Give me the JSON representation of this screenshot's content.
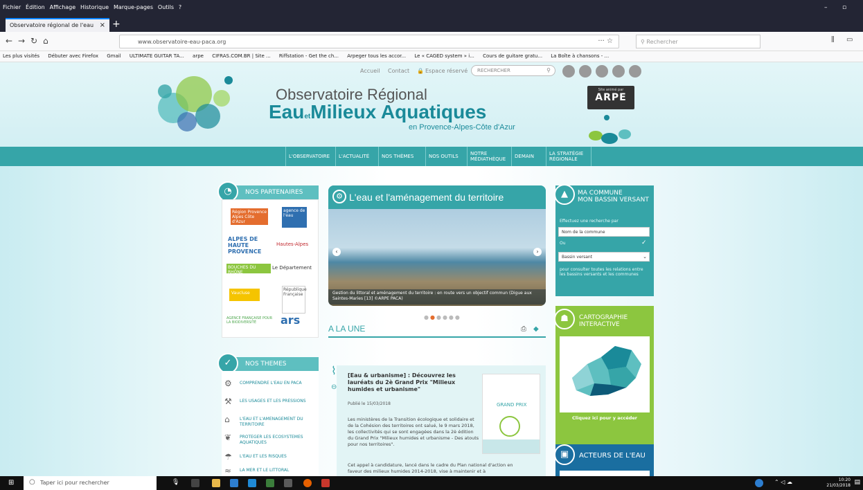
{
  "browser": {
    "menu": [
      "Fichier",
      "Édition",
      "Affichage",
      "Historique",
      "Marque-pages",
      "Outils",
      "?"
    ],
    "tab_title": "Observatoire régional de l'eau",
    "url": "www.observatoire-eau-paca.org",
    "search_placeholder": "Rechercher",
    "bookmarks": [
      "Les plus visités",
      "Débuter avec Firefox",
      "Gmail",
      "ULTIMATE GUITAR TA...",
      "arpe",
      "CIFRAS.COM.BR | Site ...",
      "Riffstation - Get the ch...",
      "Arpeger tous les accor...",
      "Le « CAGED system » i...",
      "Cours de guitare gratu...",
      "La Boîte à chansons - ..."
    ]
  },
  "site": {
    "toplinks": {
      "home": "Accueil",
      "contact": "Contact",
      "private": "Espace réservé"
    },
    "search_placeholder": "RECHERCHER",
    "logo": {
      "line1": "Observatoire Régional",
      "line2a": "Eau",
      "line2et": "et",
      "line2b": "Milieux Aquatiques",
      "line3": "en Provence-Alpes-Côte d'Azur"
    },
    "arpe": {
      "small": "Site animé par",
      "big": "ARPE"
    },
    "nav": [
      "L'OBSERVATOIRE",
      "L'ACTUALITÉ",
      "NOS THÈMES",
      "NOS OUTILS",
      "NOTRE MÉDIATHÈQUE",
      "DEMAIN",
      "LA STRATÉGIE RÉGIONALE"
    ]
  },
  "left": {
    "partners_title": "NOS PARTENAIRES",
    "partners": [
      "Région Provence Alpes Côte d'Azur",
      "agence de l'eau",
      "ALPES DE HAUTE PROVENCE",
      "Hautes-Alpes",
      "BOUCHES DU RHÔNE",
      "Le Département",
      "Vaucluse",
      "République Française",
      "AGENCE FRANÇAISE POUR LA BIODIVERSITÉ",
      "ars"
    ],
    "themes_title": "NOS THEMES",
    "themes": [
      "COMPRENDRE L'EAU EN PACA",
      "LES USAGES ET LES PRESSIONS",
      "L'EAU ET L'AMENAGEMENT DU TERRITOIRE",
      "PROTEGER LES ECOSYSTEMES AQUATIQUES",
      "L'EAU ET LES RISQUES",
      "LA MER ET LE LITTORAL"
    ]
  },
  "center": {
    "slider_title": "L'eau et l'aménagement du territoire",
    "slider_caption": "Gestion du littoral et aménagement du territoire : en route vers un objectif commun (Digue aux Saintes-Maries [13] ©ARPE PACA)",
    "alaune": "A LA UNE",
    "article": {
      "title": "[Eau & urbanisme] : Découvrez les lauréats du 2è Grand Prix \"Milieux humides et urbanisme\"",
      "date": "Publié le 15/03/2018",
      "text1": "Les ministères de la Transition écologique et solidaire et de la Cohésion des territoires ont salué, le 9 mars 2018, les collectivités qui se sont engagées dans la 2è édition du Grand Prix \"Milieux humides et urbanisme - Des atouts pour nos territoires\".",
      "text2": "Cet appel à candidature, lancé dans le cadre du Plan national d'action en faveur des milieux humides 2014-2018, vise à maintenir et à",
      "img_label": "GRAND PRIX"
    }
  },
  "right": {
    "commune_title1": "MA COMMUNE",
    "commune_title2": "MON BASSIN VERSANT",
    "commune_search_label": "Effectuez une recherche par",
    "commune_field": "Nom de la commune",
    "commune_or": "Ou",
    "commune_select": "Bassin versant",
    "commune_note": "pour consulter toutes les relations entre les bassins versants et les communes",
    "carto_title1": "CARTOGRAPHIE",
    "carto_title2": "INTERACTIVE",
    "carto_link": "Cliquez ici pour y accéder",
    "acteurs_title": "ACTEURS DE L'EAU"
  },
  "taskbar": {
    "search": "Taper ici pour rechercher",
    "time": "10:20",
    "date": "21/03/2018"
  }
}
